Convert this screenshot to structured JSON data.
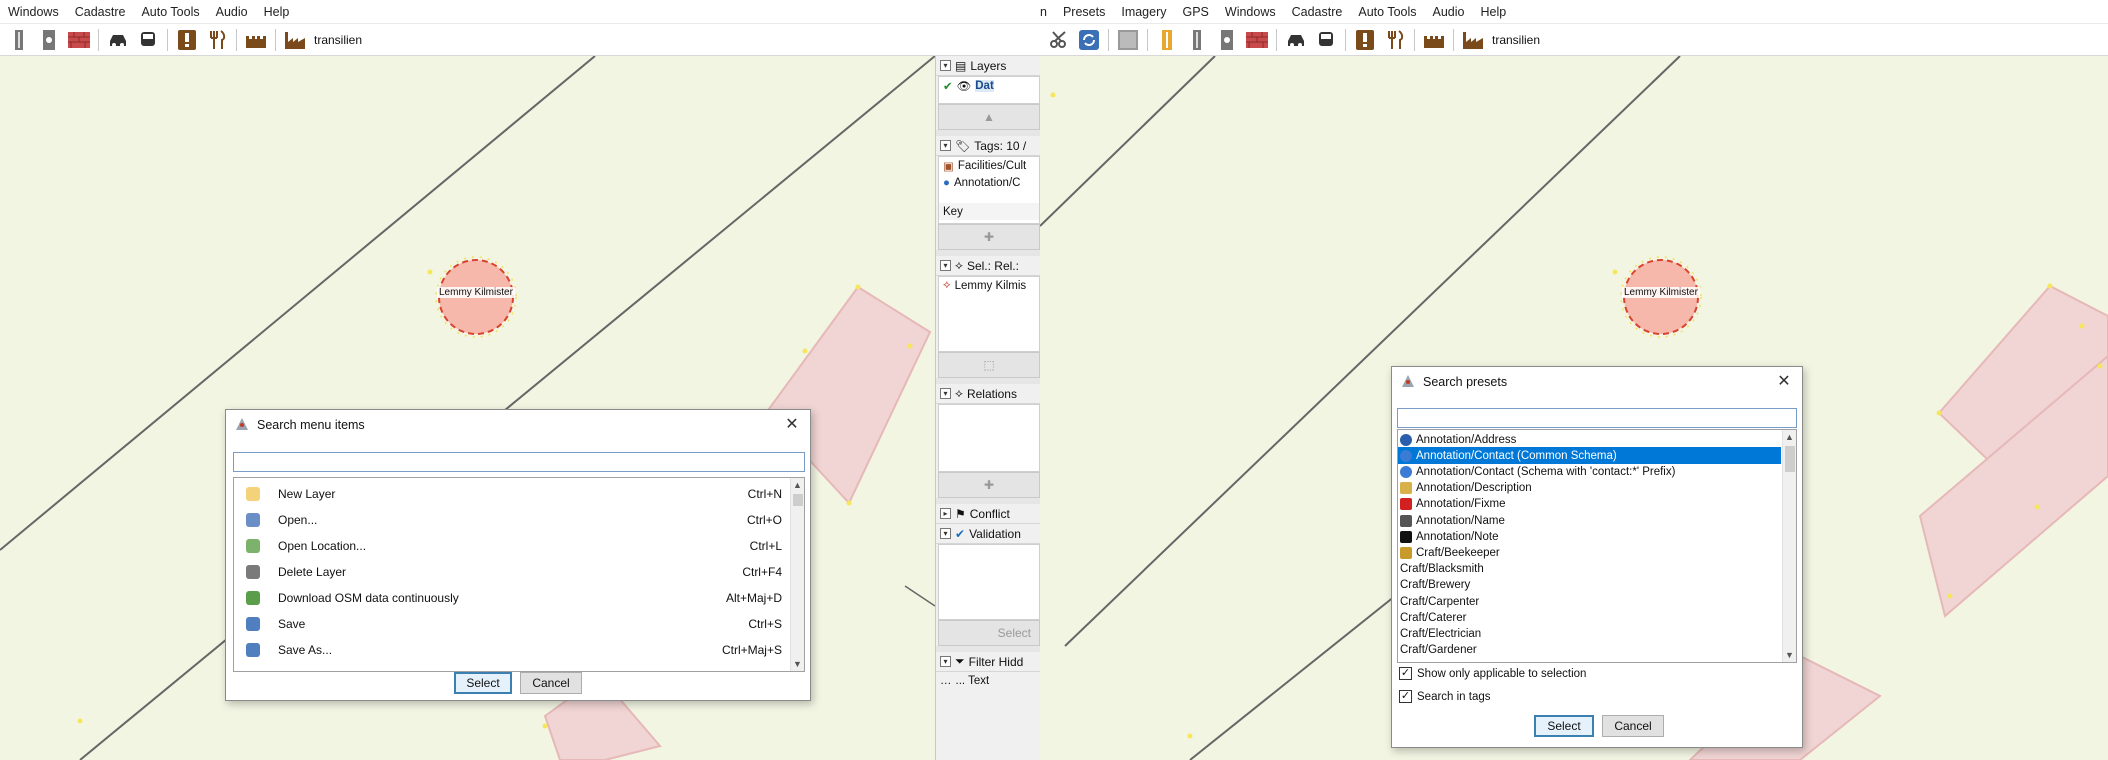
{
  "left": {
    "menubar": [
      "Windows",
      "Cadastre",
      "Auto Tools",
      "Audio",
      "Help"
    ],
    "toolbar_label": "transilien",
    "node_label": "Lemmy Kilmister",
    "side": {
      "layers_title": "Layers",
      "layer_item": "Dat",
      "tags_title": "Tags: 10 /",
      "tag1": "Facilities/Cult",
      "tag2": "Annotation/C",
      "key_label": "Key",
      "sel_title": "Sel.: Rel.:",
      "sel_item": "Lemmy Kilmis",
      "relations_title": "Relations",
      "conflict_title": "Conflict",
      "validation_title": "Validation",
      "select_label": "Select",
      "filter_title": "Filter Hidd",
      "text_label": "... Text"
    },
    "dialog": {
      "title": "Search menu items",
      "items": [
        {
          "label": "New Layer",
          "shortcut": "Ctrl+N",
          "icon": "new-layer-icon",
          "color": "#f4d27a"
        },
        {
          "label": "Open...",
          "shortcut": "Ctrl+O",
          "icon": "open-icon",
          "color": "#6a8fc7"
        },
        {
          "label": "Open Location...",
          "shortcut": "Ctrl+L",
          "icon": "open-location-icon",
          "color": "#7cb26b"
        },
        {
          "label": "Delete Layer",
          "shortcut": "Ctrl+F4",
          "icon": "delete-layer-icon",
          "color": "#7a7a7a"
        },
        {
          "label": "Download OSM data continuously",
          "shortcut": "Alt+Maj+D",
          "icon": "download-icon",
          "color": "#5b9e4a"
        },
        {
          "label": "Save",
          "shortcut": "Ctrl+S",
          "icon": "save-icon",
          "color": "#4f7fbf"
        },
        {
          "label": "Save As...",
          "shortcut": "Ctrl+Maj+S",
          "icon": "save-as-icon",
          "color": "#4f7fbf"
        }
      ],
      "select": "Select",
      "cancel": "Cancel"
    }
  },
  "right": {
    "menubar": [
      "n",
      "Presets",
      "Imagery",
      "GPS",
      "Windows",
      "Cadastre",
      "Auto Tools",
      "Audio",
      "Help"
    ],
    "toolbar_label": "transilien",
    "node_label": "Lemmy Kilmister",
    "dialog": {
      "title": "Search presets",
      "items": [
        {
          "label": "Annotation/Address",
          "icon": "address-icon",
          "color": "#2b5fad"
        },
        {
          "label": "Annotation/Contact (Common Schema)",
          "icon": "contact-globe-icon",
          "color": "#3a7bd5",
          "selected": true
        },
        {
          "label": "Annotation/Contact (Schema with 'contact:*' Prefix)",
          "icon": "contact-globe-icon",
          "color": "#3a7bd5"
        },
        {
          "label": "Annotation/Description",
          "icon": "description-icon",
          "color": "#d8b04a"
        },
        {
          "label": "Annotation/Fixme",
          "icon": "fixme-icon",
          "color": "#d02020"
        },
        {
          "label": "Annotation/Name",
          "icon": "name-icon",
          "color": "#555555"
        },
        {
          "label": "Annotation/Note",
          "icon": "note-icon",
          "color": "#111111"
        },
        {
          "label": "Craft/Beekeeper",
          "icon": "beekeeper-icon",
          "color": "#c89a2a"
        },
        {
          "label": "Craft/Blacksmith",
          "icon": "",
          "color": ""
        },
        {
          "label": "Craft/Brewery",
          "icon": "",
          "color": ""
        },
        {
          "label": "Craft/Carpenter",
          "icon": "",
          "color": ""
        },
        {
          "label": "Craft/Caterer",
          "icon": "",
          "color": ""
        },
        {
          "label": "Craft/Electrician",
          "icon": "",
          "color": ""
        },
        {
          "label": "Craft/Gardener",
          "icon": "",
          "color": ""
        }
      ],
      "chk_applicable": "Show only applicable to selection",
      "chk_tags": "Search in tags",
      "select": "Select",
      "cancel": "Cancel"
    }
  },
  "colors": {
    "map_bg": "#f2f5e2",
    "building": "#f1d4d4",
    "building_stroke": "#e6b8b8",
    "node_fill": "#f6b8aa",
    "selection": "#0078d7"
  }
}
